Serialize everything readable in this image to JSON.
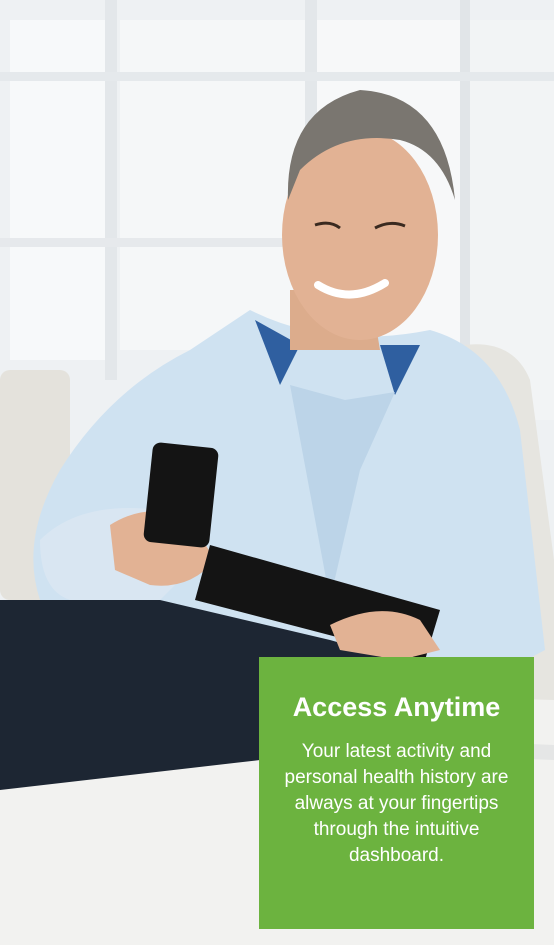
{
  "photo": {
    "subject": "man-on-sofa-with-phone-and-tablet",
    "colors": {
      "shirt": "#cfe2f1",
      "collar": "#2f5fa0",
      "trousers": "#1d2633",
      "device": "#141414",
      "hair": "#7a7670",
      "skin": "#e2b294"
    }
  },
  "card": {
    "title": "Access Anytime",
    "body": "Your latest activity and personal health history are always at your fingertips through the intuitive dashboard.",
    "background": "#6cb33f",
    "text_color": "#ffffff"
  }
}
